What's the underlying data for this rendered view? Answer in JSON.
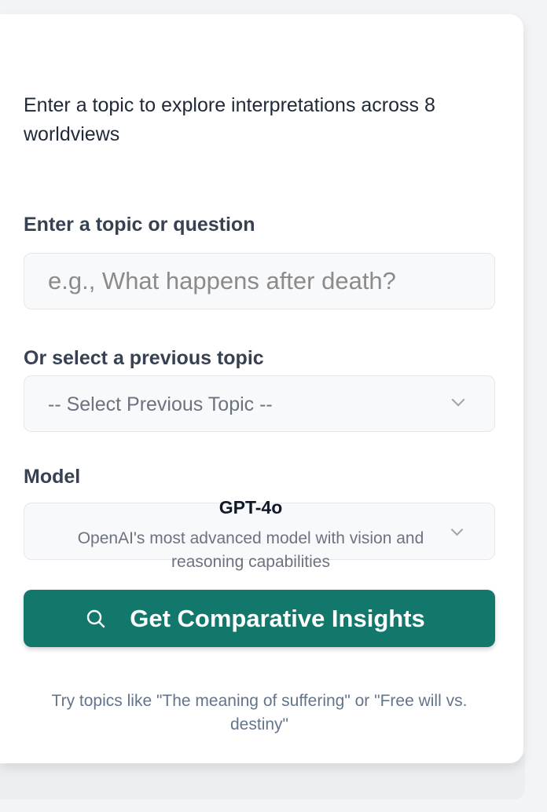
{
  "intro": {
    "text": "Enter a topic to explore interpretations across 8 worldviews"
  },
  "topic": {
    "label": "Enter a topic or question",
    "value": "",
    "placeholder": "e.g., What happens after death?"
  },
  "previous": {
    "label": "Or select a previous topic",
    "selected": "-- Select Previous Topic --"
  },
  "model": {
    "label": "Model",
    "selected_name": "GPT-4o",
    "selected_description": "OpenAI's most advanced model with vision and reasoning capabilities"
  },
  "cta": {
    "label": "Get Comparative Insights",
    "icon": "search-icon"
  },
  "hint": {
    "text": "Try topics like \"The meaning of suffering\" or \"Free will vs. destiny\""
  },
  "colors": {
    "accent": "#11786b",
    "card": "#ffffff",
    "background": "#f3f4f6",
    "input_bg": "#f8f9fb",
    "label": "#374151",
    "muted": "#6b7280"
  }
}
